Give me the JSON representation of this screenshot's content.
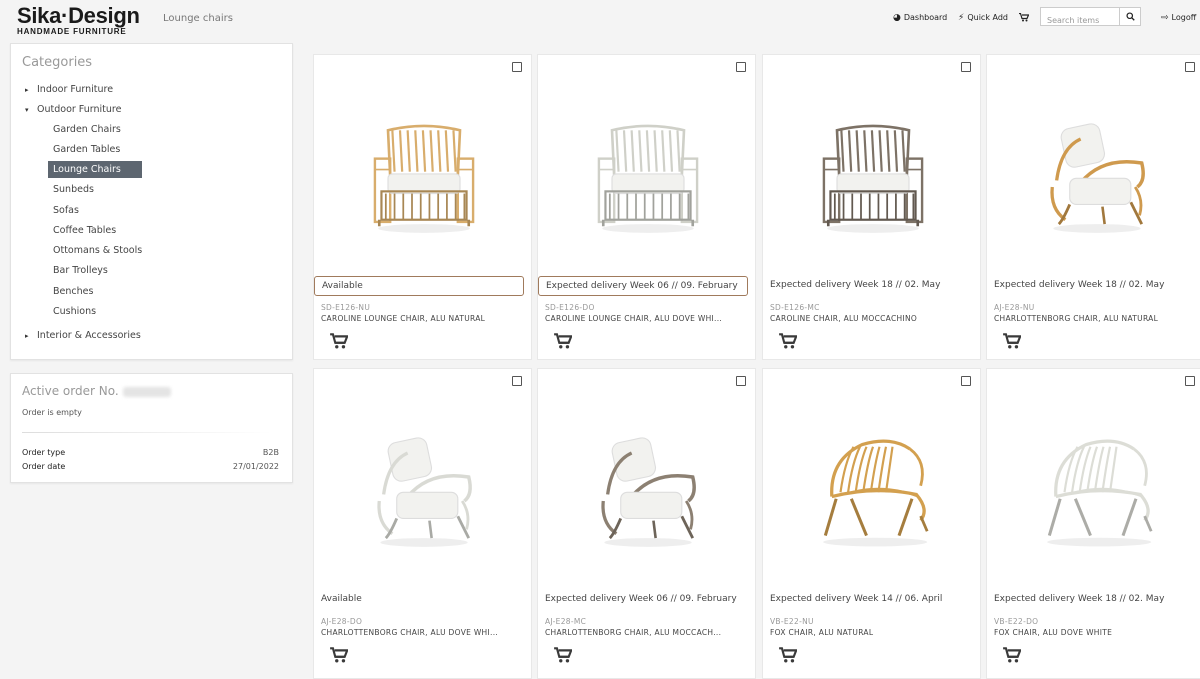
{
  "header": {
    "brand": "Sika·Design",
    "brand_tagline": "HANDMADE FURNITURE",
    "breadcrumb": "Lounge chairs",
    "nav": {
      "dashboard": "Dashboard",
      "quick_add": "Quick Add",
      "logoff": "Logoff"
    },
    "search": {
      "placeholder": "Search items",
      "value": ""
    }
  },
  "categories": {
    "title": "Categories",
    "items": [
      {
        "label": "Indoor Furniture",
        "expanded": false
      },
      {
        "label": "Outdoor Furniture",
        "expanded": true
      },
      {
        "label": "Interior & Accessories",
        "expanded": false
      }
    ],
    "outdoor_children": [
      "Garden Chairs",
      "Garden Tables",
      "Lounge Chairs",
      "Sunbeds",
      "Sofas",
      "Coffee Tables",
      "Ottomans & Stools",
      "Bar Trolleys",
      "Benches",
      "Cushions"
    ],
    "active": "Lounge Chairs"
  },
  "order": {
    "title": "Active order No.",
    "status": "Order is empty",
    "type_label": "Order type",
    "type_value": "B2B",
    "date_label": "Order date",
    "date_value": "27/01/2022"
  },
  "products": [
    {
      "status": "Available",
      "sku": "SD-E126-NU",
      "name": "CAROLINE LOUNGE CHAIR, ALU NATURAL",
      "color": "#d8ad6c",
      "style": "caroline"
    },
    {
      "status": "Expected delivery Week 06 // 09. February",
      "sku": "SD-E126-DO",
      "name": "CAROLINE LOUNGE CHAIR, ALU DOVE WHI...",
      "color": "#cfd0c8",
      "style": "caroline"
    },
    {
      "status": "Expected delivery Week 18 // 02. May",
      "sku": "SD-E126-MC",
      "name": "CAROLINE CHAIR, ALU MOCCACHINO",
      "color": "#7d7266",
      "style": "caroline"
    },
    {
      "status": "Expected delivery Week 18 // 02. May",
      "sku": "AJ-E28-NU",
      "name": "CHARLOTTENBORG CHAIR, ALU NATURAL",
      "color": "#cf9a4e",
      "style": "charlottenborg"
    },
    {
      "status": "Available",
      "sku": "AJ-E28-DO",
      "name": "CHARLOTTENBORG CHAIR, ALU DOVE WHI...",
      "color": "#d9dad4",
      "style": "charlottenborg"
    },
    {
      "status": "Expected delivery Week 06 // 09. February",
      "sku": "AJ-E28-MC",
      "name": "CHARLOTTENBORG CHAIR, ALU MOCCACH...",
      "color": "#8c8072",
      "style": "charlottenborg"
    },
    {
      "status": "Expected delivery Week 14 // 06. April",
      "sku": "VB-E22-NU",
      "name": "FOX CHAIR, ALU NATURAL",
      "color": "#d3a04f",
      "style": "fox"
    },
    {
      "status": "Expected delivery Week 18 // 02. May",
      "sku": "VB-E22-DO",
      "name": "FOX CHAIR, ALU DOVE WHITE",
      "color": "#dcddd6",
      "style": "fox"
    }
  ],
  "colors": {
    "active_category_bg": "#5d6670",
    "status_border": "#a07a5c",
    "page_bg": "#f4f4f4"
  }
}
